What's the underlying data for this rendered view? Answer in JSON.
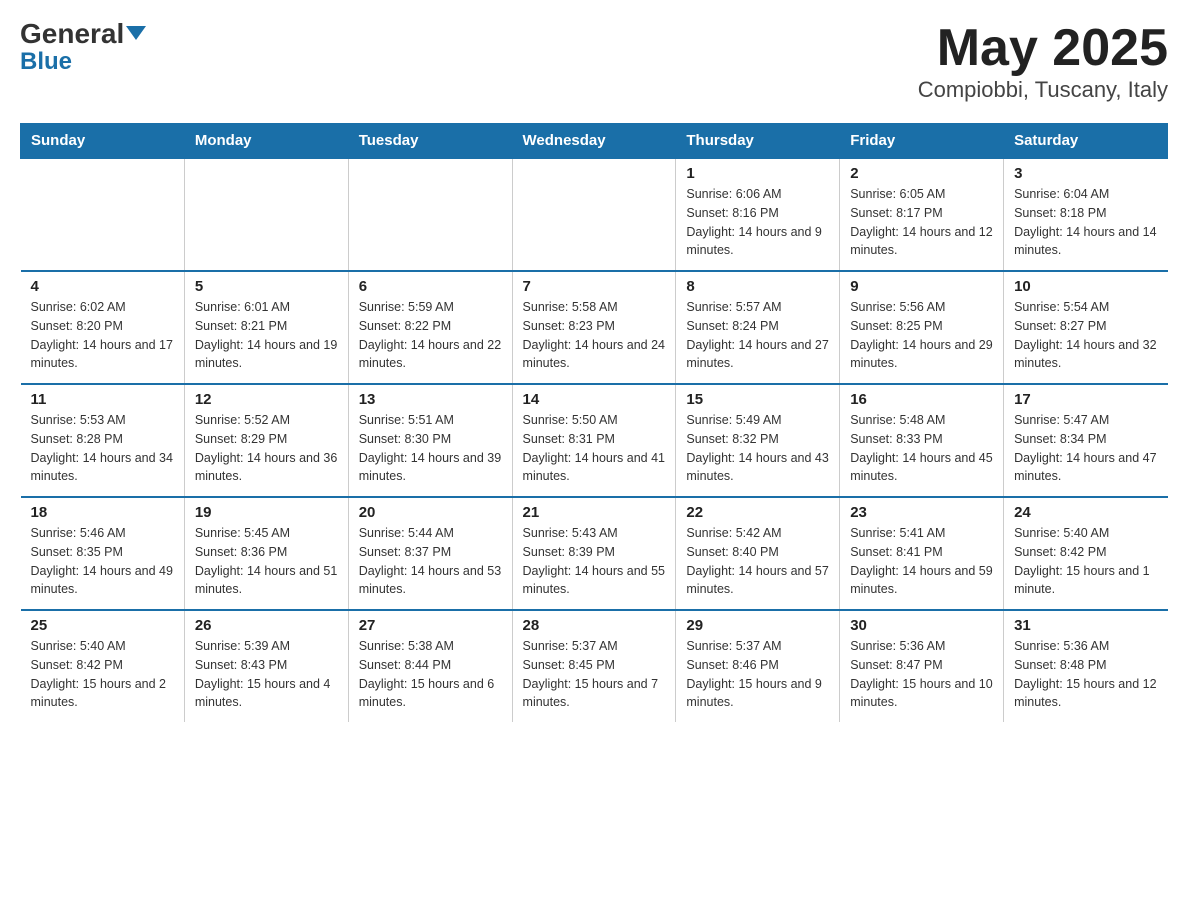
{
  "logo": {
    "general": "General",
    "blue": "Blue"
  },
  "title": "May 2025",
  "subtitle": "Compiobbi, Tuscany, Italy",
  "days_of_week": [
    "Sunday",
    "Monday",
    "Tuesday",
    "Wednesday",
    "Thursday",
    "Friday",
    "Saturday"
  ],
  "weeks": [
    [
      {
        "day": "",
        "info": ""
      },
      {
        "day": "",
        "info": ""
      },
      {
        "day": "",
        "info": ""
      },
      {
        "day": "",
        "info": ""
      },
      {
        "day": "1",
        "info": "Sunrise: 6:06 AM\nSunset: 8:16 PM\nDaylight: 14 hours and 9 minutes."
      },
      {
        "day": "2",
        "info": "Sunrise: 6:05 AM\nSunset: 8:17 PM\nDaylight: 14 hours and 12 minutes."
      },
      {
        "day": "3",
        "info": "Sunrise: 6:04 AM\nSunset: 8:18 PM\nDaylight: 14 hours and 14 minutes."
      }
    ],
    [
      {
        "day": "4",
        "info": "Sunrise: 6:02 AM\nSunset: 8:20 PM\nDaylight: 14 hours and 17 minutes."
      },
      {
        "day": "5",
        "info": "Sunrise: 6:01 AM\nSunset: 8:21 PM\nDaylight: 14 hours and 19 minutes."
      },
      {
        "day": "6",
        "info": "Sunrise: 5:59 AM\nSunset: 8:22 PM\nDaylight: 14 hours and 22 minutes."
      },
      {
        "day": "7",
        "info": "Sunrise: 5:58 AM\nSunset: 8:23 PM\nDaylight: 14 hours and 24 minutes."
      },
      {
        "day": "8",
        "info": "Sunrise: 5:57 AM\nSunset: 8:24 PM\nDaylight: 14 hours and 27 minutes."
      },
      {
        "day": "9",
        "info": "Sunrise: 5:56 AM\nSunset: 8:25 PM\nDaylight: 14 hours and 29 minutes."
      },
      {
        "day": "10",
        "info": "Sunrise: 5:54 AM\nSunset: 8:27 PM\nDaylight: 14 hours and 32 minutes."
      }
    ],
    [
      {
        "day": "11",
        "info": "Sunrise: 5:53 AM\nSunset: 8:28 PM\nDaylight: 14 hours and 34 minutes."
      },
      {
        "day": "12",
        "info": "Sunrise: 5:52 AM\nSunset: 8:29 PM\nDaylight: 14 hours and 36 minutes."
      },
      {
        "day": "13",
        "info": "Sunrise: 5:51 AM\nSunset: 8:30 PM\nDaylight: 14 hours and 39 minutes."
      },
      {
        "day": "14",
        "info": "Sunrise: 5:50 AM\nSunset: 8:31 PM\nDaylight: 14 hours and 41 minutes."
      },
      {
        "day": "15",
        "info": "Sunrise: 5:49 AM\nSunset: 8:32 PM\nDaylight: 14 hours and 43 minutes."
      },
      {
        "day": "16",
        "info": "Sunrise: 5:48 AM\nSunset: 8:33 PM\nDaylight: 14 hours and 45 minutes."
      },
      {
        "day": "17",
        "info": "Sunrise: 5:47 AM\nSunset: 8:34 PM\nDaylight: 14 hours and 47 minutes."
      }
    ],
    [
      {
        "day": "18",
        "info": "Sunrise: 5:46 AM\nSunset: 8:35 PM\nDaylight: 14 hours and 49 minutes."
      },
      {
        "day": "19",
        "info": "Sunrise: 5:45 AM\nSunset: 8:36 PM\nDaylight: 14 hours and 51 minutes."
      },
      {
        "day": "20",
        "info": "Sunrise: 5:44 AM\nSunset: 8:37 PM\nDaylight: 14 hours and 53 minutes."
      },
      {
        "day": "21",
        "info": "Sunrise: 5:43 AM\nSunset: 8:39 PM\nDaylight: 14 hours and 55 minutes."
      },
      {
        "day": "22",
        "info": "Sunrise: 5:42 AM\nSunset: 8:40 PM\nDaylight: 14 hours and 57 minutes."
      },
      {
        "day": "23",
        "info": "Sunrise: 5:41 AM\nSunset: 8:41 PM\nDaylight: 14 hours and 59 minutes."
      },
      {
        "day": "24",
        "info": "Sunrise: 5:40 AM\nSunset: 8:42 PM\nDaylight: 15 hours and 1 minute."
      }
    ],
    [
      {
        "day": "25",
        "info": "Sunrise: 5:40 AM\nSunset: 8:42 PM\nDaylight: 15 hours and 2 minutes."
      },
      {
        "day": "26",
        "info": "Sunrise: 5:39 AM\nSunset: 8:43 PM\nDaylight: 15 hours and 4 minutes."
      },
      {
        "day": "27",
        "info": "Sunrise: 5:38 AM\nSunset: 8:44 PM\nDaylight: 15 hours and 6 minutes."
      },
      {
        "day": "28",
        "info": "Sunrise: 5:37 AM\nSunset: 8:45 PM\nDaylight: 15 hours and 7 minutes."
      },
      {
        "day": "29",
        "info": "Sunrise: 5:37 AM\nSunset: 8:46 PM\nDaylight: 15 hours and 9 minutes."
      },
      {
        "day": "30",
        "info": "Sunrise: 5:36 AM\nSunset: 8:47 PM\nDaylight: 15 hours and 10 minutes."
      },
      {
        "day": "31",
        "info": "Sunrise: 5:36 AM\nSunset: 8:48 PM\nDaylight: 15 hours and 12 minutes."
      }
    ]
  ]
}
